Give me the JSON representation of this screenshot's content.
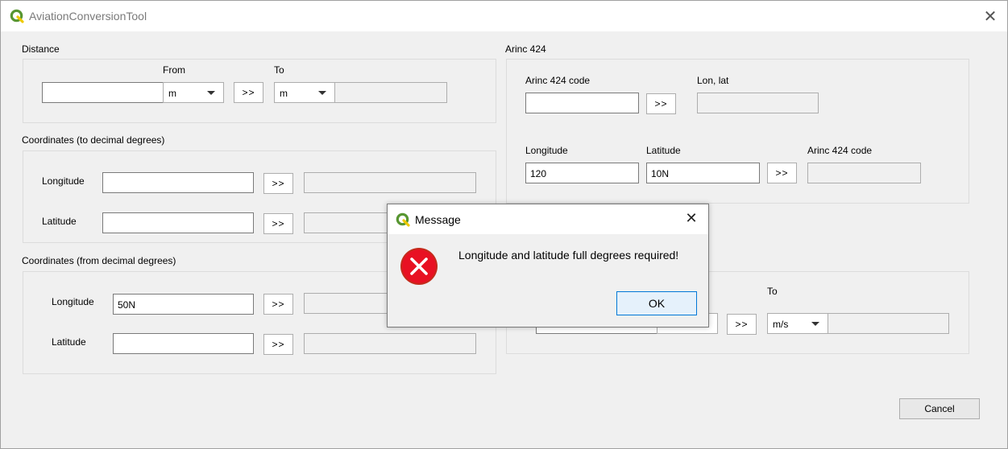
{
  "window": {
    "title": "AviationConversionTool",
    "close_glyph": "✕"
  },
  "distance": {
    "group_label": "Distance",
    "from_label": "From",
    "to_label": "To",
    "input_value": "",
    "from_unit": "m",
    "convert_label": ">>",
    "to_unit": "m",
    "result": ""
  },
  "coords_to_dd": {
    "group_label": "Coordinates (to decimal degrees)",
    "longitude_label": "Longitude",
    "longitude_value": "",
    "latitude_label": "Latitude",
    "latitude_value": "",
    "convert_label": ">>"
  },
  "coords_from_dd": {
    "group_label": "Coordinates (from decimal degrees)",
    "longitude_label": "Longitude",
    "longitude_value": "50N",
    "latitude_label": "Latitude",
    "latitude_value": "",
    "convert_label": ">>"
  },
  "arinc": {
    "group_label": "Arinc 424",
    "code_label": "Arinc 424 code",
    "code_value": "",
    "lonlat_label": "Lon, lat",
    "lonlat_value": "",
    "longitude_label": "Longitude",
    "longitude_value": "120",
    "latitude_label": "Latitude",
    "latitude_value": "10N",
    "code_out_label": "Arinc 424 code",
    "code_out_value": "",
    "convert_label": ">>"
  },
  "speed": {
    "to_label": "To",
    "to_unit": "m/s",
    "convert_label": ">>",
    "result": ""
  },
  "footer": {
    "cancel_label": "Cancel"
  },
  "dialog": {
    "title": "Message",
    "close_glyph": "✕",
    "message": "Longitude and latitude full degrees required!",
    "ok_label": "OK",
    "icon": "error-icon",
    "icon_color": "#e81123"
  },
  "colors": {
    "qgis_green": "#589632",
    "qgis_yellow": "#eec900"
  }
}
